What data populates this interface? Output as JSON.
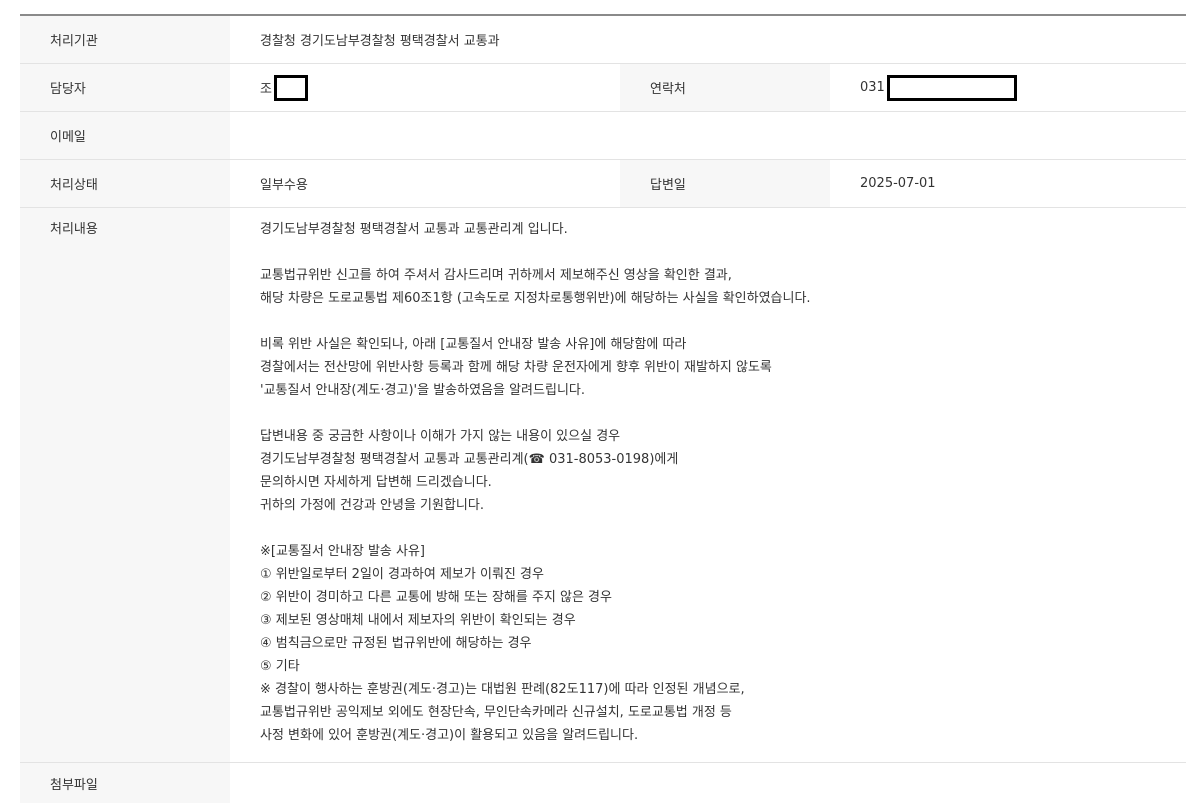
{
  "rows": {
    "agency": {
      "label": "처리기관",
      "value": "경찰청 경기도남부경찰청 평택경찰서 교통과"
    },
    "manager": {
      "label": "담당자",
      "value": "조"
    },
    "contact": {
      "label": "연락처",
      "value": "031"
    },
    "email": {
      "label": "이메일",
      "value": ""
    },
    "status": {
      "label": "처리상태",
      "value": "일부수용"
    },
    "answer_date": {
      "label": "답변일",
      "value": "2025-07-01"
    },
    "content": {
      "label": "처리내용",
      "value": "경기도남부경찰청 평택경찰서 교통과 교통관리계 입니다.\n\n교통법규위반 신고를 하여 주셔서 감사드리며 귀하께서 제보해주신 영상을 확인한 결과,\n해당 차량은 도로교통법 제60조1항 (고속도로 지정차로통행위반)에 해당하는 사실을 확인하였습니다.\n\n비록 위반 사실은 확인되나, 아래 [교통질서 안내장 발송 사유]에 해당함에 따라\n경찰에서는 전산망에 위반사항 등록과 함께 해당 차량 운전자에게 향후 위반이 재발하지 않도록\n'교통질서 안내장(계도·경고)'을 발송하였음을 알려드립니다.\n\n답변내용 중 궁금한 사항이나 이해가 가지 않는 내용이 있으실 경우\n경기도남부경찰청 평택경찰서 교통과 교통관리계(☎ 031-8053-0198)에게\n문의하시면 자세하게 답변해 드리겠습니다.\n귀하의 가정에 건강과 안녕을 기원합니다.\n\n※[교통질서 안내장 발송 사유]\n① 위반일로부터 2일이 경과하여 제보가 이뤄진 경우\n② 위반이 경미하고 다른 교통에 방해 또는 장해를 주지 않은 경우\n③ 제보된 영상매체 내에서 제보자의 위반이 확인되는 경우\n④ 범칙금으로만 규정된 법규위반에 해당하는 경우\n⑤ 기타\n※ 경찰이 행사하는 훈방권(계도·경고)는 대법원 판례(82도117)에 따라 인정된 개념으로,\n교통법규위반 공익제보 외에도 현장단속, 무인단속카메라 신규설치, 도로교통법 개정 등\n사정 변화에 있어 훈방권(계도·경고)이 활용되고 있음을 알려드립니다."
    },
    "attachment": {
      "label": "첨부파일",
      "value": ""
    }
  }
}
